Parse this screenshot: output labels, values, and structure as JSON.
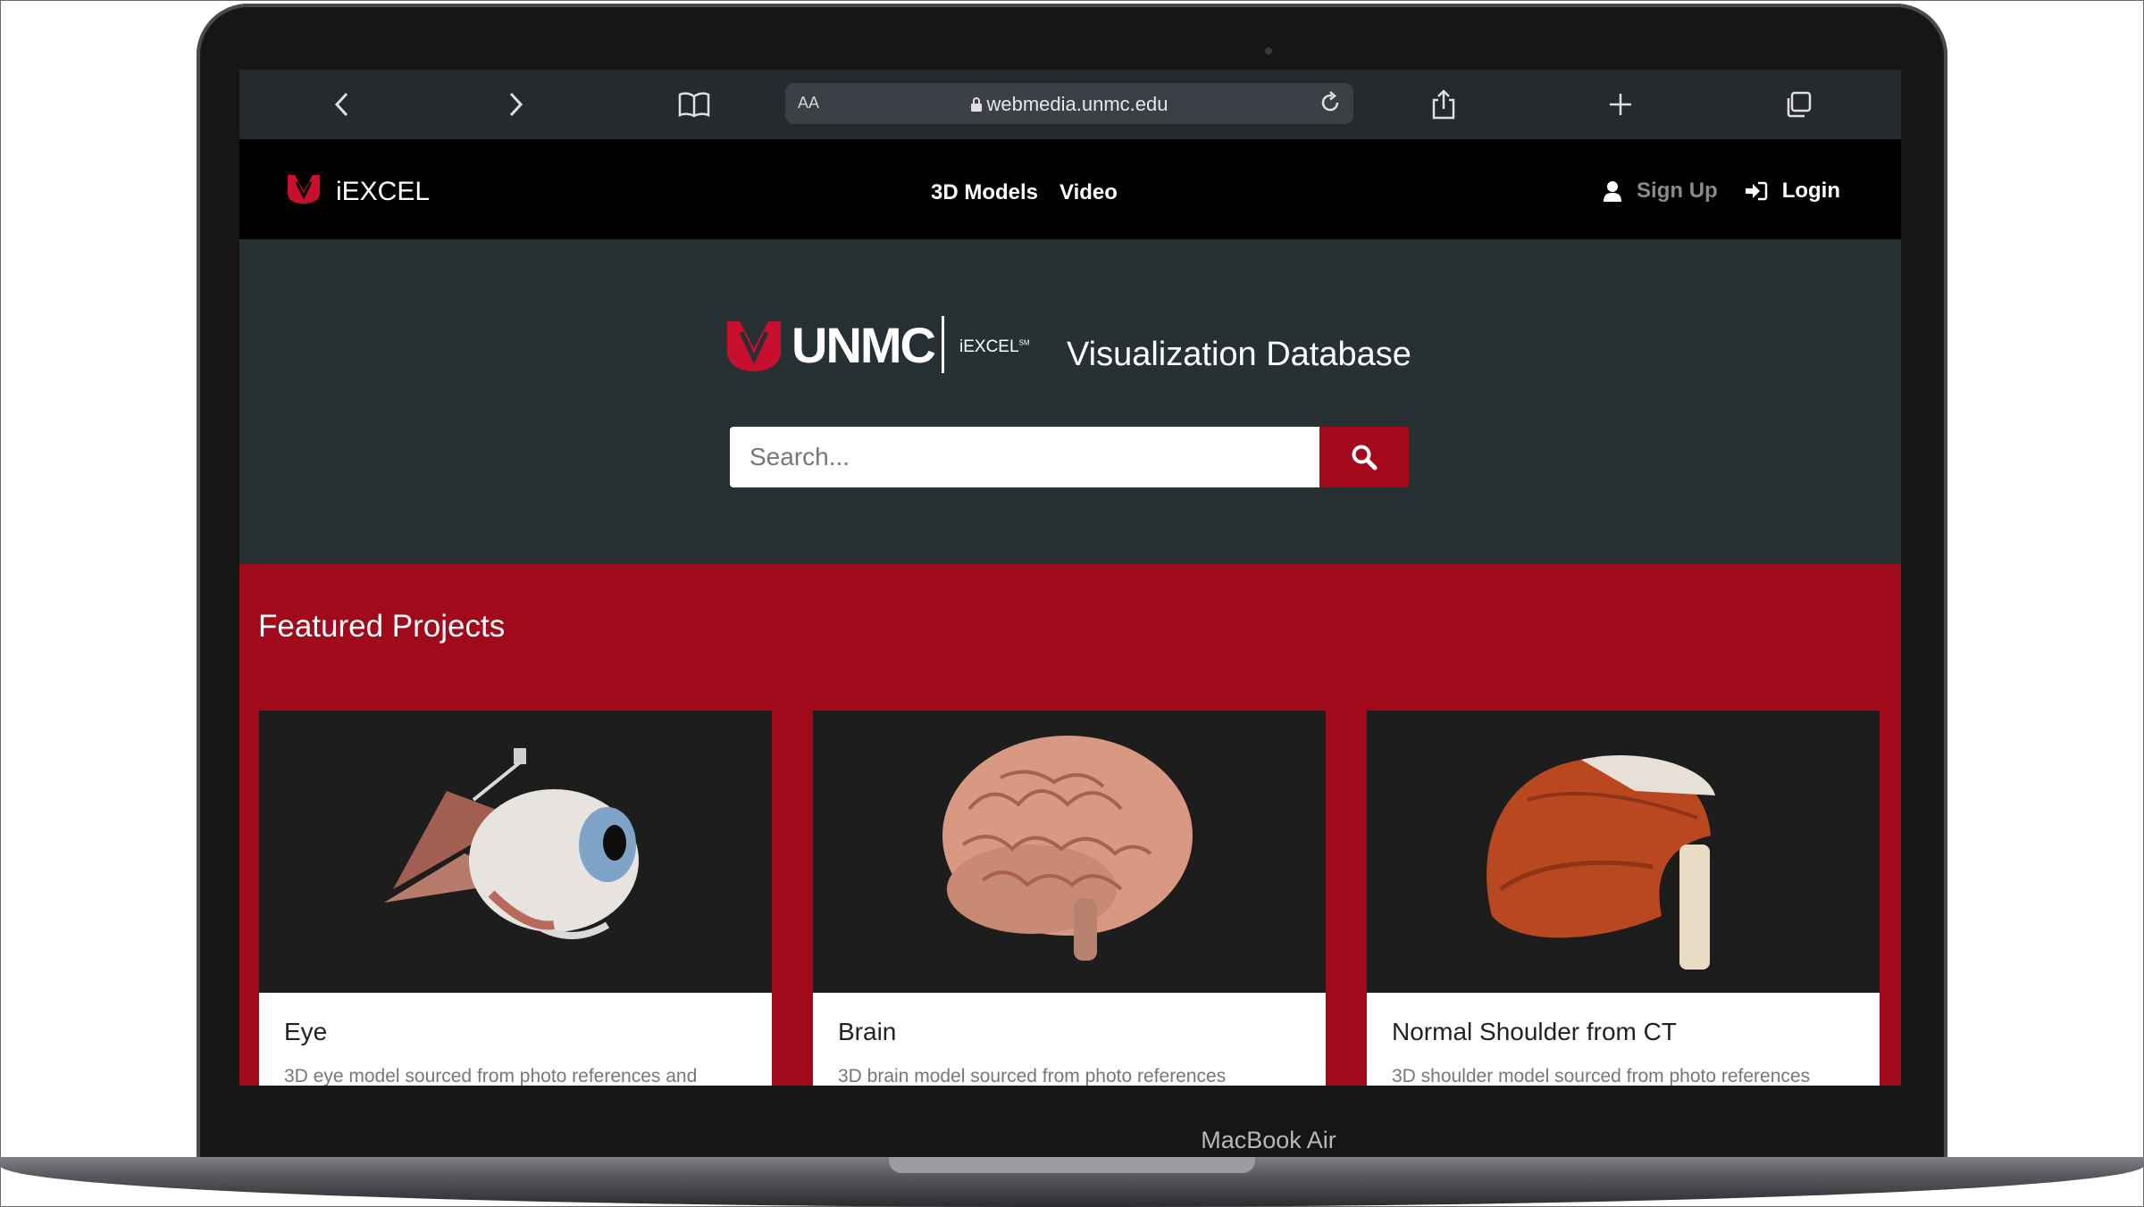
{
  "device": {
    "label": "MacBook Air"
  },
  "browser": {
    "reader_label": "AA",
    "url": "webmedia.unmc.edu",
    "icons": [
      "chevron-left-icon",
      "chevron-right-icon",
      "book-icon",
      "lock-icon",
      "reload-icon",
      "share-icon",
      "plus-icon",
      "tabs-icon"
    ]
  },
  "nav": {
    "site_name": "iEXCEL",
    "links": [
      "3D Models",
      "Video"
    ],
    "sign_up": "Sign Up",
    "login": "Login"
  },
  "hero": {
    "brand": "UNMC",
    "sub_brand": "iEXCEL",
    "sub_brand_mark": "SM",
    "title": "Visualization Database",
    "search_placeholder": "Search..."
  },
  "featured": {
    "heading": "Featured Projects",
    "cards": [
      {
        "title": "Eye",
        "desc": "3D eye model sourced from photo references and"
      },
      {
        "title": "Brain",
        "desc": "3D brain model sourced from photo references"
      },
      {
        "title": "Normal Shoulder from CT",
        "desc": "3D shoulder model sourced from photo references"
      }
    ]
  },
  "colors": {
    "accent": "#a00a1a",
    "hero_bg": "#273033",
    "nav_bg": "#000000"
  }
}
